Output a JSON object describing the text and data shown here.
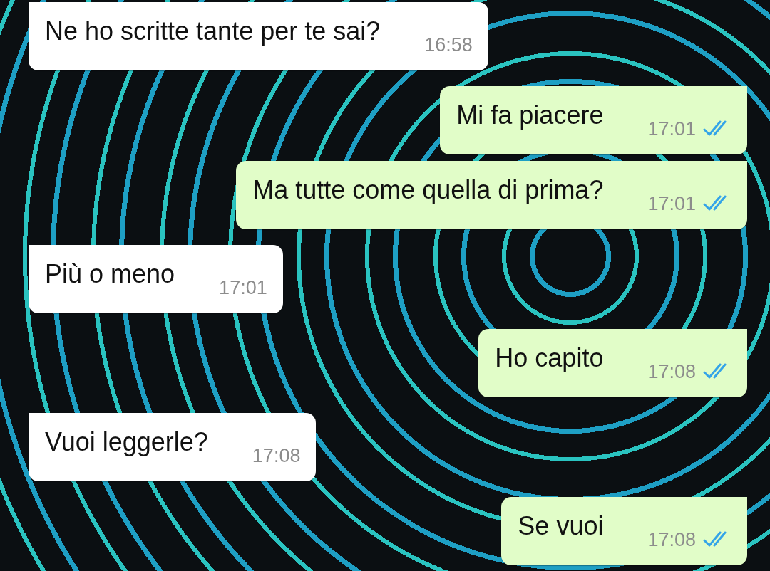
{
  "messages": [
    {
      "kind": "incoming",
      "text": "Ne ho scritte tante per te sai?",
      "time": "16:58"
    },
    {
      "kind": "outgoing",
      "text": "Mi fa piacere",
      "time": "17:01",
      "read": true
    },
    {
      "kind": "outgoing",
      "text": "Ma tutte come quella di prima?",
      "time": "17:01",
      "read": true
    },
    {
      "kind": "incoming",
      "text": "Più o meno",
      "time": "17:01"
    },
    {
      "kind": "outgoing",
      "text": "Ho capito",
      "time": "17:08",
      "read": true
    },
    {
      "kind": "incoming",
      "text": "Vuoi leggerle?",
      "time": "17:08"
    },
    {
      "kind": "outgoing",
      "text": "Se vuoi",
      "time": "17:08",
      "read": true
    }
  ]
}
